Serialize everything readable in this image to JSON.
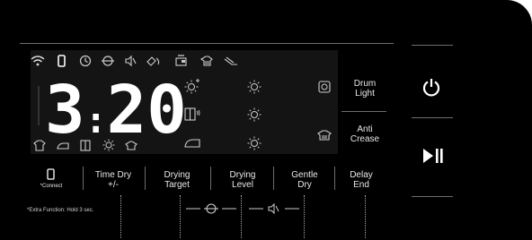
{
  "display": {
    "time": "3:20",
    "hours": "3",
    "colon": ":",
    "minutes": "20"
  },
  "status_icons": [
    "wifi-icon",
    "phone-icon",
    "timer-icon",
    "child-lock-icon",
    "mute-icon",
    "detergent-icon",
    "kettle-icon",
    "tshirt-steam-icon",
    "iron-board-icon"
  ],
  "right_options": {
    "drum_light": "Drum\nLight",
    "anti_crease": "Anti\nCrease"
  },
  "buttons": {
    "connect": "*Connect",
    "time_dry": "Time Dry\n+/-",
    "drying_target": "Drying\nTarget",
    "drying_level": "Drying\nLevel",
    "gentle_dry": "Gentle\nDry",
    "delay_end": "Delay\nEnd"
  },
  "footnote": "*Extra Function: Hold 3 sec.",
  "colors": {
    "panel": "#000000",
    "lcd": "#141414",
    "text": "#e8e8e8",
    "divider": "#6d6d6d"
  }
}
